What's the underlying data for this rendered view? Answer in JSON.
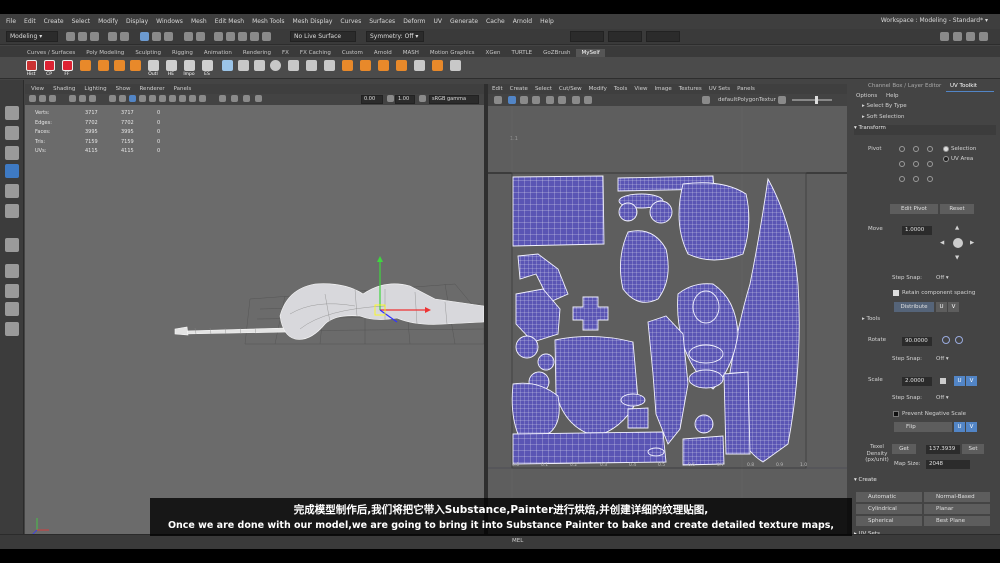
{
  "menubar": {
    "items": [
      "File",
      "Edit",
      "Create",
      "Select",
      "Modify",
      "Display",
      "Windows",
      "Mesh",
      "Edit Mesh",
      "Mesh Tools",
      "Mesh Display",
      "Curves",
      "Surfaces",
      "Deform",
      "UV",
      "Generate",
      "Cache",
      "Arnold",
      "Help"
    ],
    "workspace_label": "Workspace :",
    "workspace_value": "Modeling - Standard*"
  },
  "statusline": {
    "mode": "Modeling",
    "live_surface": "No Live Surface",
    "symmetry": "Symmetry: Off"
  },
  "shelf": {
    "tabs": [
      "Curves / Surfaces",
      "Poly Modeling",
      "Sculpting",
      "Rigging",
      "Animation",
      "Rendering",
      "FX",
      "FX Caching",
      "Custom",
      "Arnold",
      "MASH",
      "Motion Graphics",
      "XGen",
      "TURTLE",
      "GoZBrush",
      "MySelf"
    ],
    "active_tab": "MySelf",
    "icon_labels": [
      "Hist",
      "CP",
      "FF",
      "",
      "",
      "",
      "",
      "",
      "Outl",
      "HE",
      "Impo",
      "ES"
    ]
  },
  "viewport": {
    "menu": [
      "View",
      "Shading",
      "Lighting",
      "Show",
      "Renderer",
      "Panels"
    ],
    "field_a": "0.00",
    "field_b": "1.00",
    "colorspace": "sRGB gamma",
    "hud": [
      {
        "label": "Verts:",
        "a": "3717",
        "b": "3717",
        "c": "0"
      },
      {
        "label": "Edges:",
        "a": "7702",
        "b": "7702",
        "c": "0"
      },
      {
        "label": "Faces:",
        "a": "3995",
        "b": "3995",
        "c": "0"
      },
      {
        "label": "Tris:",
        "a": "7159",
        "b": "7159",
        "c": "0"
      },
      {
        "label": "UVs:",
        "a": "4115",
        "b": "4115",
        "c": "0"
      }
    ]
  },
  "uv_editor": {
    "menu": [
      "Edit",
      "Create",
      "Select",
      "Cut/Sew",
      "Modify",
      "Tools",
      "View",
      "Image",
      "Textures",
      "UV Sets",
      "Panels"
    ],
    "texture_name": "defaultPolygonTextur",
    "corner_label": "1.1",
    "tick_labels": [
      "0.0",
      "0.1",
      "0.2",
      "0.3",
      "0.4",
      "0.5",
      "0.6",
      "0.7",
      "0.8",
      "0.9",
      "1.0"
    ]
  },
  "right_panel": {
    "tabs": [
      "Channel Box / Layer Editor",
      "UV Toolkit"
    ],
    "subtabs": [
      "Options",
      "Help"
    ],
    "select_by_type": "Select By Type",
    "soft_selection": "Soft Selection",
    "transform": "Transform",
    "pivot_label": "Pivot",
    "pivot_options": [
      "Selection",
      "UV Area"
    ],
    "edit_pivot": "Edit Pivot",
    "reset": "Reset",
    "move_label": "Move",
    "move_value": "1.0000",
    "step_snap_label": "Step Snap:",
    "off": "Off",
    "retain_spacing": "Retain component spacing",
    "distribute": "Distribute",
    "u": "U",
    "v": "V",
    "tools": "Tools",
    "rotate_label": "Rotate",
    "rotate_value": "90.0000",
    "scale_label": "Scale",
    "scale_value": "2.0000",
    "prevent_negative": "Prevent Negative Scale",
    "flip": "Flip",
    "texel_label": "Texel Density (px/unit)",
    "get": "Get",
    "texel_value": "137.3939",
    "set": "Set",
    "map_size_label": "Map Size:",
    "map_size_value": "2048",
    "create": "Create",
    "create_buttons": [
      "Automatic",
      "Normal-Based",
      "Cylindrical",
      "Planar",
      "Spherical",
      "Best Plane"
    ],
    "uv_sets": "UV Sets"
  },
  "subtitles": {
    "zh": "完成模型制作后,我们将把它带入Substance,Painter进行烘焙,并创建详细的纹理贴图,",
    "en": "Once we are done with our model,we are going to bring it into Substance Painter to bake and create detailed texture maps,"
  },
  "timeline": {
    "mel": "MEL"
  },
  "colors": {
    "uv_fill": "#5a55b4",
    "uv_wire": "#e8e8f4",
    "accent_blue": "#5285c6",
    "maya_logo": "#1fa4e4"
  }
}
